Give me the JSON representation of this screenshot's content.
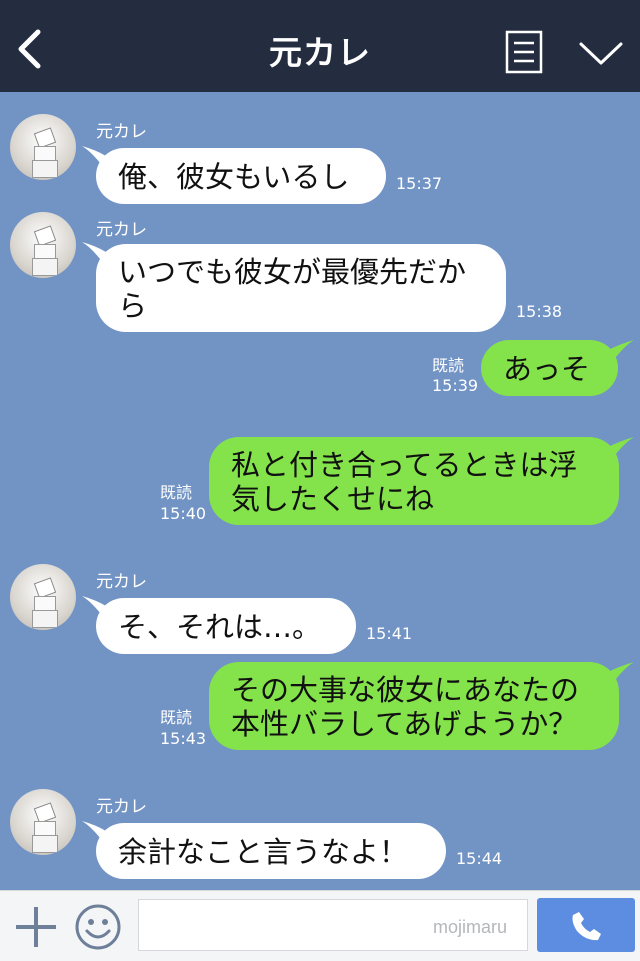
{
  "header": {
    "title": "元カレ",
    "back_icon": "chevron-left-icon",
    "menu_icon": "list-icon",
    "expand_icon": "chevron-down-icon"
  },
  "messages": [
    {
      "side": "in",
      "sender": "元カレ",
      "text": "俺、彼女もいるし",
      "time": "15:37"
    },
    {
      "side": "in",
      "sender": "元カレ",
      "text": "いつでも彼女が最優先だから",
      "time": "15:38"
    },
    {
      "side": "out",
      "read": "既読",
      "text": "あっそ",
      "time": "15:39"
    },
    {
      "side": "out",
      "read": "既読",
      "text": "私と付き合ってるときは浮気したくせにね",
      "time": "15:40"
    },
    {
      "side": "in",
      "sender": "元カレ",
      "text": "そ、それは…。",
      "time": "15:41"
    },
    {
      "side": "out",
      "read": "既読",
      "text": "その大事な彼女にあなたの本性バラしてあげようか？",
      "time": "15:43"
    },
    {
      "side": "in",
      "sender": "元カレ",
      "text": "余計なこと言うなよ！",
      "time": "15:44"
    }
  ],
  "input": {
    "value": "",
    "placeholder": "",
    "watermark": "mojimaru",
    "plus_icon": "plus-icon",
    "emoji_icon": "smiley-icon",
    "call_icon": "phone-icon"
  },
  "colors": {
    "header_bg": "#242d40",
    "chat_bg": "#7294c5",
    "bubble_in": "#ffffff",
    "bubble_out": "#84e24a",
    "call_button": "#5d8de0"
  }
}
